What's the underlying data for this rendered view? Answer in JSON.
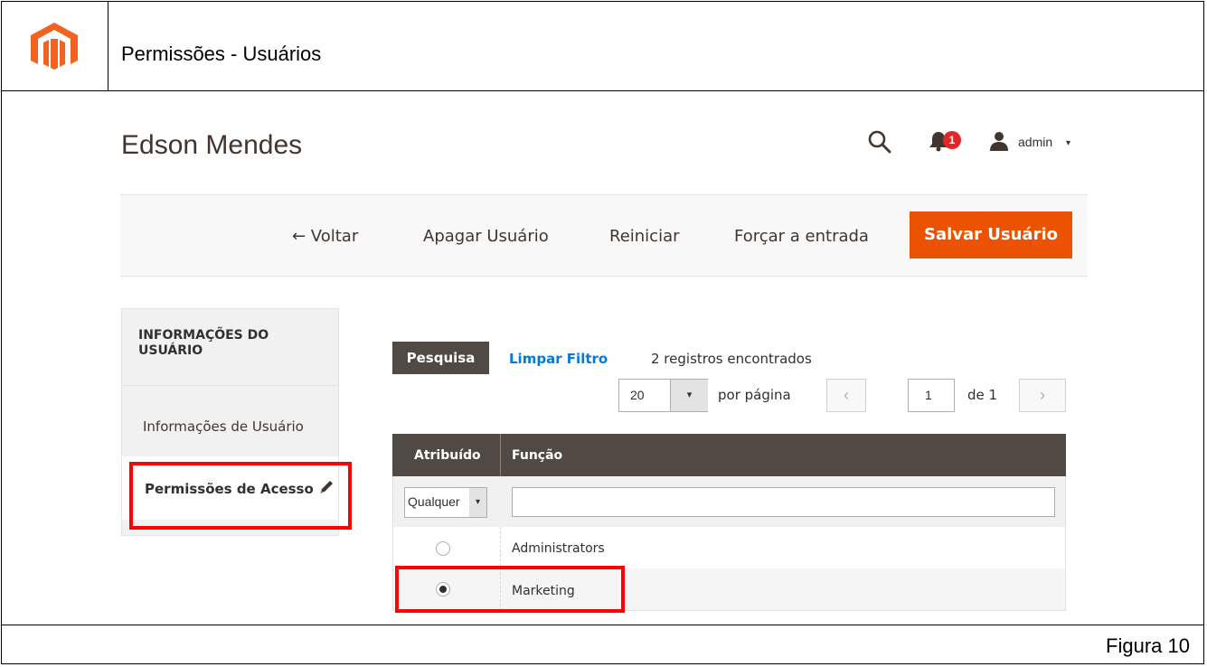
{
  "doc": {
    "header_title": "Permissões - Usuários",
    "figure_label": "Figura 10"
  },
  "page": {
    "title": "Edson Mendes",
    "notifications_count": "1",
    "user_label": "admin",
    "user_caret": "▾"
  },
  "toolbar": {
    "back_label": "← Voltar",
    "delete_label": "Apagar Usuário",
    "reset_label": "Reiniciar",
    "force_login_label": "Forçar a entrada",
    "save_label": "Salvar Usuário"
  },
  "sidebar": {
    "heading": "INFORMAÇÕES DO USUÁRIO",
    "items": [
      {
        "label": "Informações de Usuário",
        "active": false
      },
      {
        "label": "Permissões de Acesso",
        "active": true
      }
    ]
  },
  "grid": {
    "search_button": "Pesquisa",
    "clear_filter": "Limpar Filtro",
    "records_found": "2 registros encontrados",
    "per_page_value": "20",
    "per_page_caret": "▾",
    "per_page_label": "por página",
    "prev_label": "‹",
    "next_label": "›",
    "current_page": "1",
    "total_pages_label": "de 1",
    "columns": [
      "Atribuído",
      "Função"
    ],
    "assigned_filter_value": "Qualquer",
    "assigned_filter_caret": "▾",
    "function_filter_value": "",
    "rows": [
      {
        "role": "Administrators",
        "selected": false
      },
      {
        "role": "Marketing",
        "selected": true
      }
    ]
  },
  "colors": {
    "accent": "#eb5202",
    "grid_header": "#514943",
    "link": "#007bdb",
    "highlight": "#ff0000"
  }
}
